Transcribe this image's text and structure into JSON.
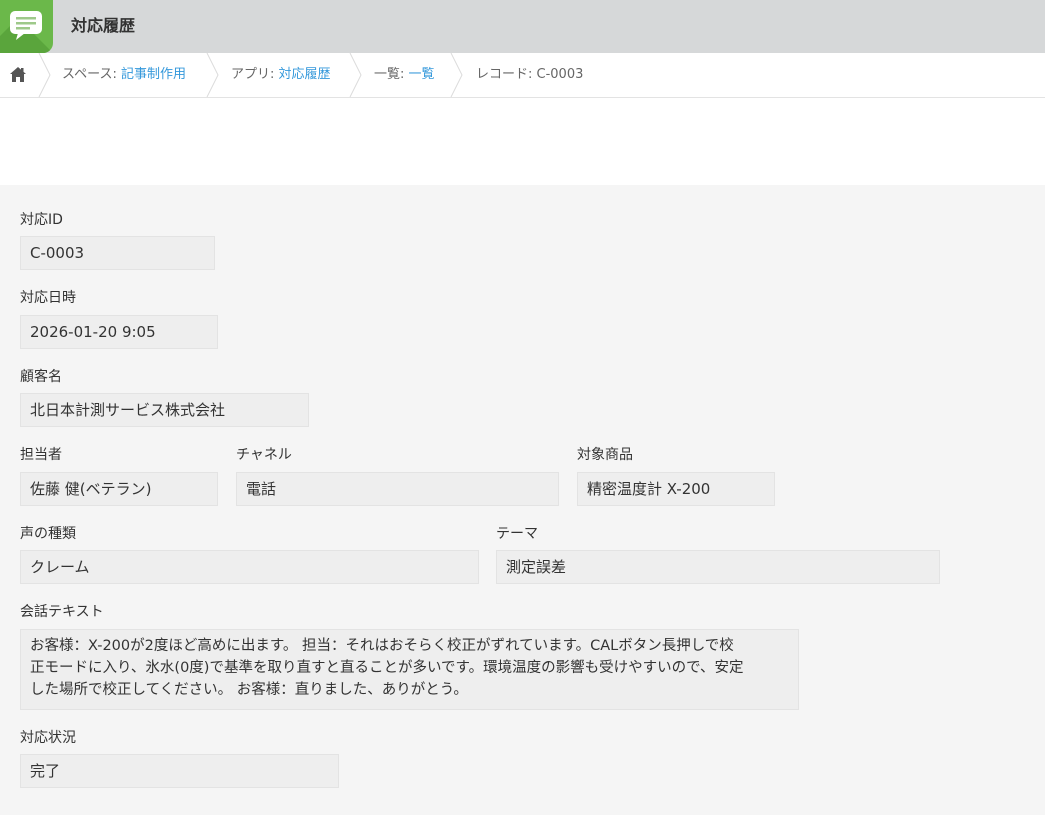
{
  "app": {
    "title": "対応履歴",
    "icon": "chat-bubble-icon",
    "accent_color": "#6bb84a"
  },
  "breadcrumb": {
    "home_icon": "home-icon",
    "items": [
      {
        "prefix": "スペース: ",
        "link": "記事制作用"
      },
      {
        "prefix": "アプリ: ",
        "link": "対応履歴"
      },
      {
        "prefix": "一覧: ",
        "link": "一覧"
      },
      {
        "prefix": "レコード: C-0003",
        "link": ""
      }
    ],
    "link_color": "#3498db"
  },
  "record": {
    "fields": {
      "response_id": {
        "label": "対応ID",
        "value": "C-0003"
      },
      "response_datetime": {
        "label": "対応日時",
        "value": "2026-01-20 9:05"
      },
      "customer_name": {
        "label": "顧客名",
        "value": "北日本計測サービス株式会社"
      },
      "assignee": {
        "label": "担当者",
        "value": "佐藤 健(ベテラン)"
      },
      "channel": {
        "label": "チャネル",
        "value": "電話"
      },
      "product": {
        "label": "対象商品",
        "value": "精密温度計 X-200"
      },
      "voice_type": {
        "label": "声の種類",
        "value": "クレーム"
      },
      "theme": {
        "label": "テーマ",
        "value": "測定誤差"
      },
      "conversation": {
        "label": "会話テキスト",
        "lines": [
          "お客様：X-200が2度ほど高めに出ます。 担当：それはおそらく校正がずれています。CALボタン長押しで校",
          "正モードに入り、氷水(0度)で基準を取り直すと直ることが多いです。環境温度の影響も受けやすいので、安定",
          "した場所で校正してください。 お客様：直りました、ありがとう。"
        ]
      },
      "status": {
        "label": "対応状況",
        "value": "完了"
      }
    }
  }
}
